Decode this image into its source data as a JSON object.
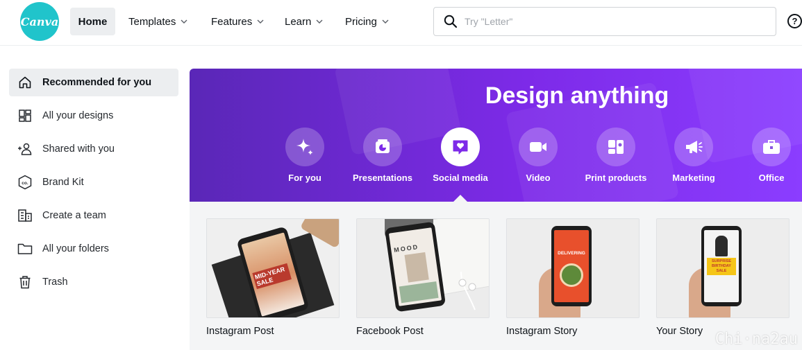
{
  "brand": {
    "logo_text": "Canva",
    "accent": "#20c4cb",
    "purple": "#7d2ae8"
  },
  "nav": {
    "home": "Home",
    "items": [
      {
        "label": "Templates"
      },
      {
        "label": "Features"
      },
      {
        "label": "Learn"
      },
      {
        "label": "Pricing"
      }
    ],
    "search_placeholder": "Try \"Letter\"",
    "help": "?"
  },
  "sidebar": {
    "items": [
      {
        "label": "Recommended for you",
        "icon": "home-icon",
        "active": true
      },
      {
        "label": "All your designs",
        "icon": "grid-icon"
      },
      {
        "label": "Shared with you",
        "icon": "users-icon"
      },
      {
        "label": "Brand Kit",
        "icon": "brand-kit-icon"
      },
      {
        "label": "Create a team",
        "icon": "building-icon"
      },
      {
        "label": "All your folders",
        "icon": "folder-icon"
      },
      {
        "label": "Trash",
        "icon": "trash-icon"
      }
    ]
  },
  "hero": {
    "title": "Design anything",
    "categories": [
      {
        "label": "For you",
        "icon": "sparkle-icon"
      },
      {
        "label": "Presentations",
        "icon": "presentation-icon"
      },
      {
        "label": "Social media",
        "icon": "heart-chat-icon",
        "active": true
      },
      {
        "label": "Video",
        "icon": "video-camera-icon"
      },
      {
        "label": "Print products",
        "icon": "print-icon"
      },
      {
        "label": "Marketing",
        "icon": "megaphone-icon"
      },
      {
        "label": "Office",
        "icon": "briefcase-icon"
      }
    ]
  },
  "templates": [
    {
      "label": "Instagram Post",
      "thumb_text": "MID-YEAR SALE"
    },
    {
      "label": "Facebook Post",
      "thumb_text": "MOOD"
    },
    {
      "label": "Instagram Story",
      "thumb_text": "DELIVERING"
    },
    {
      "label": "Your Story",
      "thumb_text": "SURPRISE BIRTHDAY SALE"
    }
  ],
  "watermark": "Chi·na2au"
}
